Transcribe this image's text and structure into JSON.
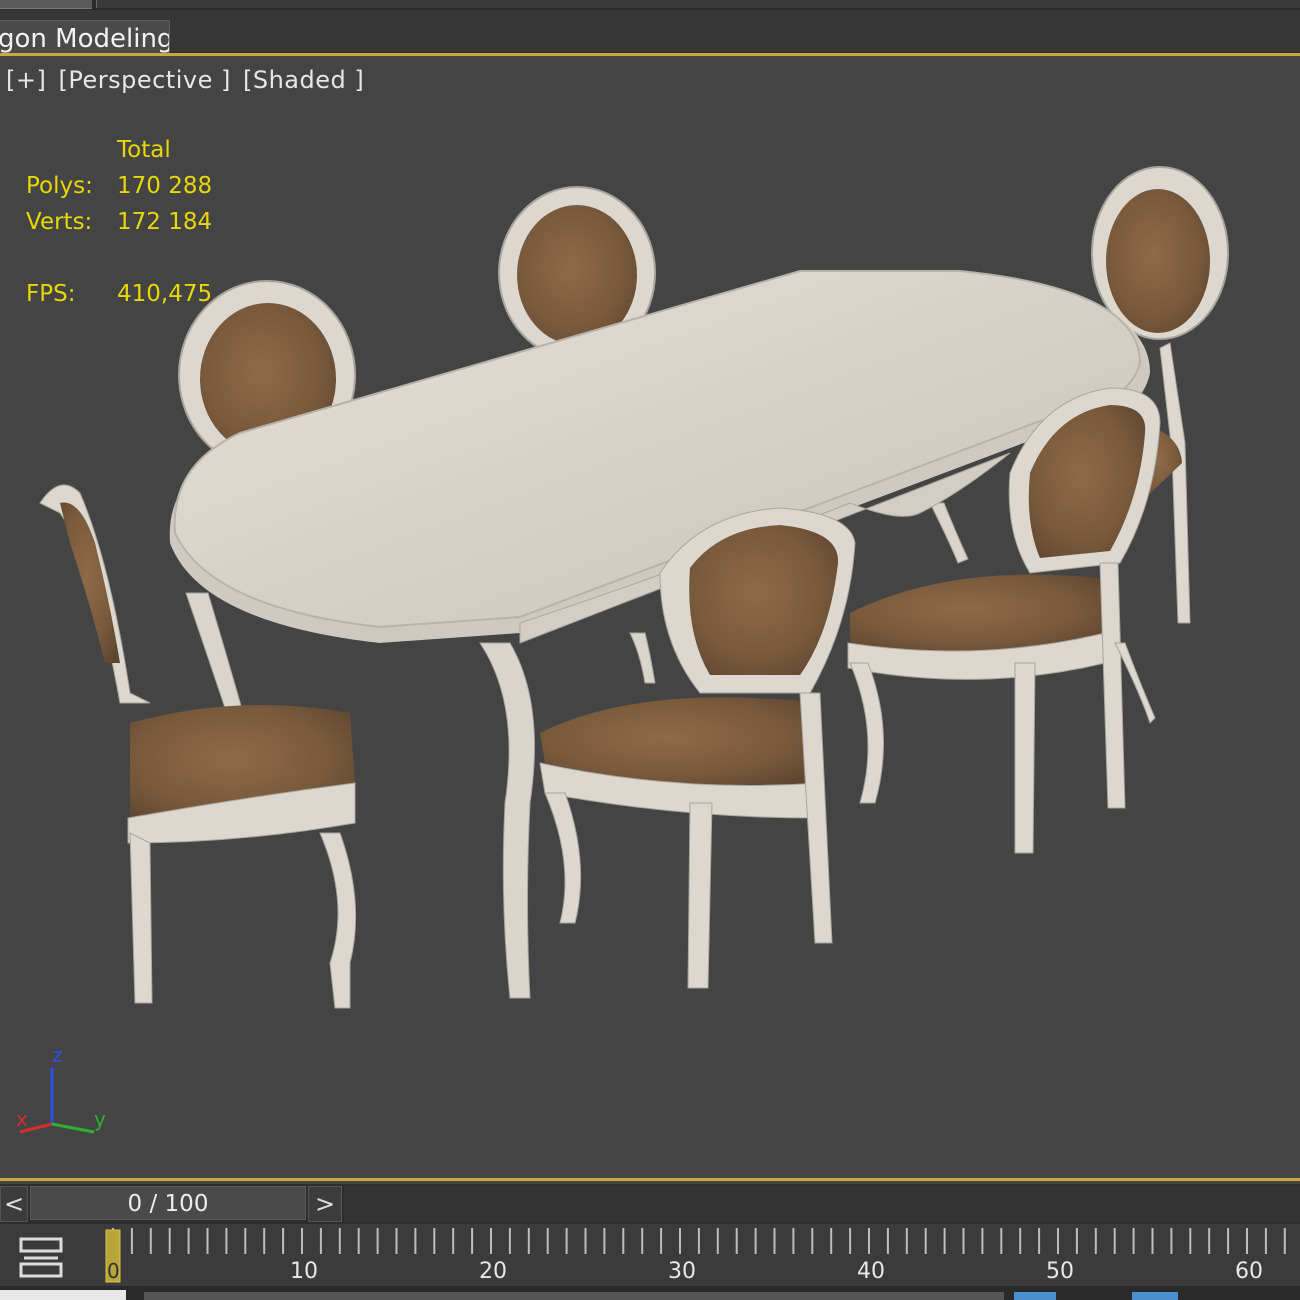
{
  "ribbon": {
    "active_tab_label": "gon Modeling"
  },
  "viewport": {
    "label_plus": "[+]",
    "label_view": "[Perspective ]",
    "label_shading": "[Shaded ]",
    "stats": {
      "header": "Total",
      "polys_label": "Polys:",
      "polys_value": "170 288",
      "verts_label": "Verts:",
      "verts_value": "172 184",
      "fps_label": "FPS:",
      "fps_value": "410,475"
    },
    "axis": {
      "x_label": "x",
      "y_label": "y",
      "z_label": "z",
      "x_color": "#d03030",
      "y_color": "#30b030",
      "z_color": "#3050e0"
    },
    "border_color": "#c7a93c"
  },
  "time_slider": {
    "prev_label": "<",
    "next_label": ">",
    "frame_text": "0 / 100"
  },
  "trackbar": {
    "current_frame_label": "0",
    "ticks": [
      "10",
      "20",
      "30",
      "40",
      "50",
      "60"
    ]
  }
}
